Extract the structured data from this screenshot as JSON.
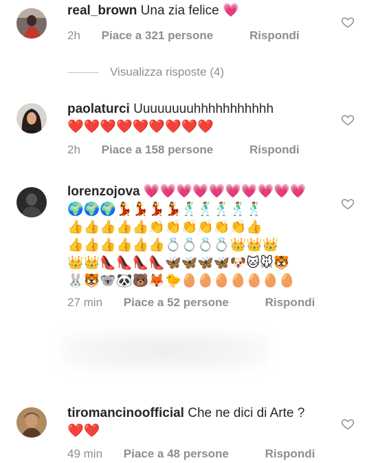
{
  "comments": [
    {
      "username": "real_brown",
      "text": "Una zia felice",
      "emoji_lines": [],
      "inline_emoji": "💗",
      "time": "2h",
      "likes": "Piace a 321 persone",
      "reply": "Rispondi"
    },
    {
      "username": "paolaturci",
      "text": "Uuuuuuuuhhhhhhhhhhh",
      "emoji_lines": [
        "❤️❤️❤️❤️❤️❤️❤️❤️❤️"
      ],
      "time": "2h",
      "likes": "Piace a 158 persone",
      "reply": "Rispondi"
    },
    {
      "username": "lorenzojova",
      "text": "",
      "inline_emoji": "💗💗💗💗💗💗💗💗💗💗",
      "emoji_lines": [
        "🌍🌍🌍💃💃💃💃🕺🕺🕺🕺🕺",
        "👍👍👍👍👍👏👏👏👏👏👏👍",
        "👍👍👍👍👍👍💍💍💍💍👑👑👑",
        "👑👑👠👠👠👠🦋🦋🦋🦋🐶🐱🐭🐯",
        "🐰🐯🐨🐼🐻🦊🐤🥚🥚🥚🥚🥚🥚🥚"
      ],
      "time": "27 min",
      "likes": "Piace a 52 persone",
      "reply": "Rispondi"
    },
    {
      "username": "tiromancinoofficial",
      "text": "Che ne dici di Arte ?",
      "emoji_lines": [
        "❤️❤️"
      ],
      "time": "49 min",
      "likes": "Piace a 48 persone",
      "reply": "Rispondi"
    }
  ],
  "view_replies": "Visualizza risposte (4)",
  "icons": {
    "like": "heart-outline-icon"
  },
  "colors": {
    "text": "#262626",
    "muted": "#8e8e8e"
  }
}
